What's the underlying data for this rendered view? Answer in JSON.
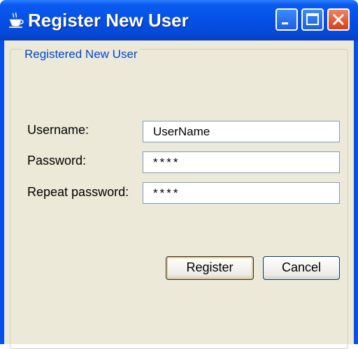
{
  "window": {
    "title": "Register New User",
    "controls": {
      "minimize": "minimize",
      "maximize": "maximize",
      "close": "close"
    }
  },
  "group": {
    "title": "Registered New User"
  },
  "form": {
    "username_label": "Username:",
    "username_value": "UserName",
    "password_label": "Password:",
    "password_value": "****",
    "repeat_label": "Repeat password:",
    "repeat_value": "****"
  },
  "buttons": {
    "register": "Register",
    "cancel": "Cancel"
  },
  "icons": {
    "app": "java-coffee-cup-icon",
    "minimize": "minimize-icon",
    "maximize": "maximize-icon",
    "close": "close-icon"
  },
  "colors": {
    "titlebar": "#0550e6",
    "client_bg": "#ece9d8",
    "group_title": "#0046d5",
    "close_button": "#d2401a",
    "default_button_focus": "#f5c170"
  }
}
